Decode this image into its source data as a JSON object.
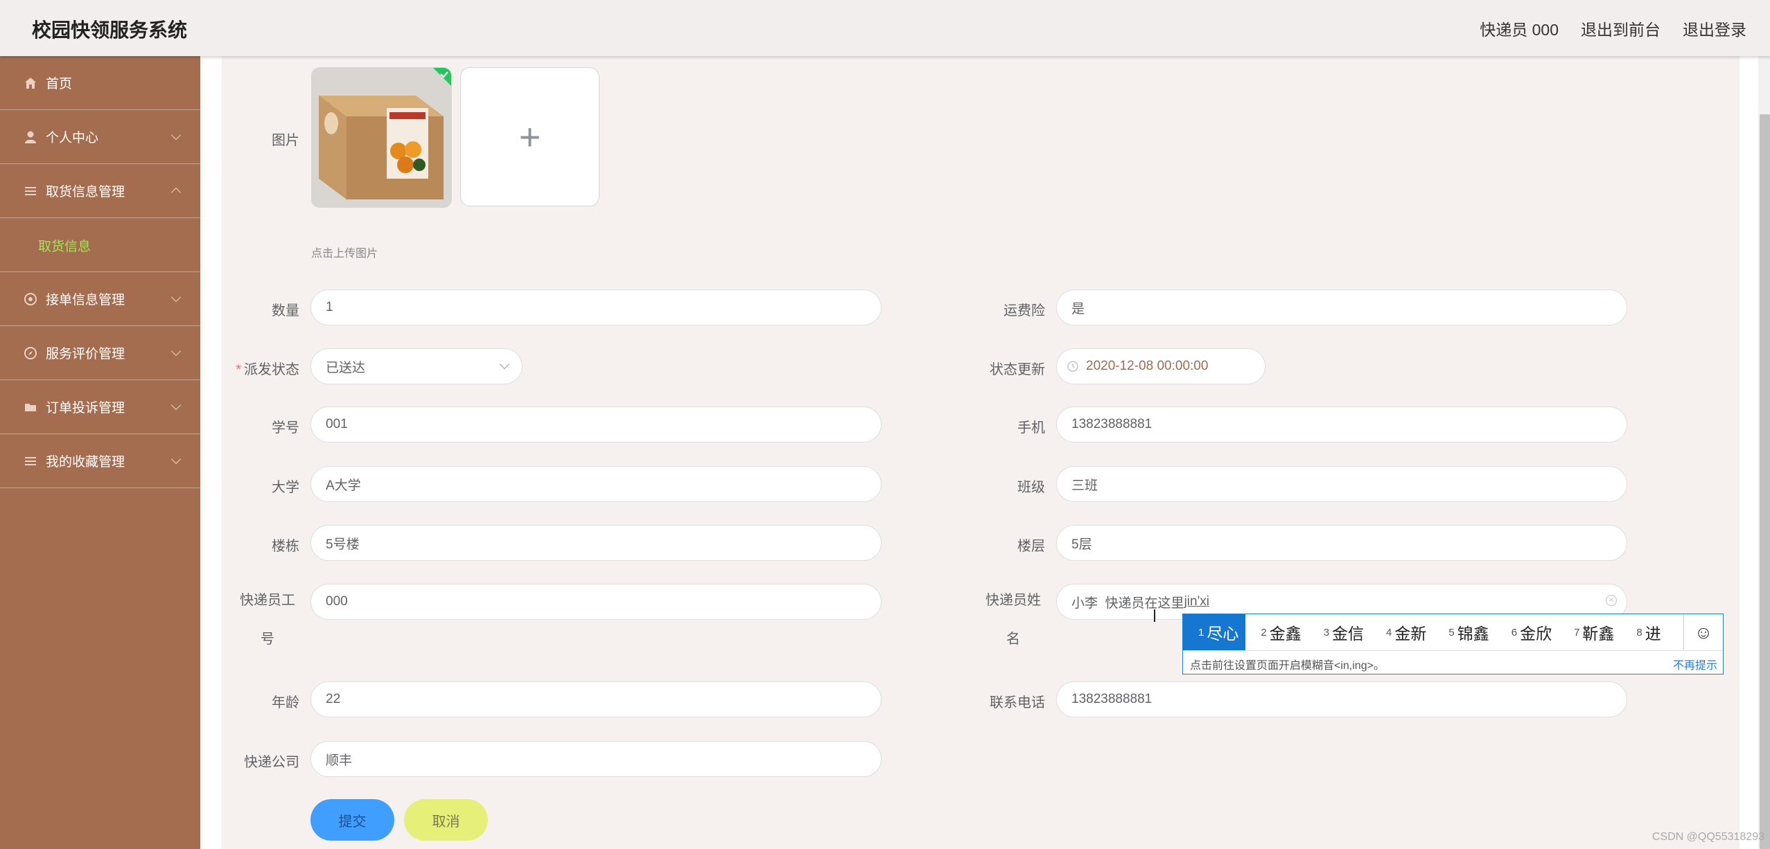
{
  "header": {
    "title": "校园快领服务系统",
    "links": [
      "快递员 000",
      "退出到前台",
      "退出登录"
    ]
  },
  "sidebar": {
    "items": [
      {
        "label": "首页",
        "icon": "home-icon"
      },
      {
        "label": "个人中心",
        "icon": "user-icon"
      },
      {
        "label": "取货信息管理",
        "icon": "menu-icon"
      },
      {
        "label": "取货信息",
        "icon": ""
      },
      {
        "label": "接单信息管理",
        "icon": "gear-icon"
      },
      {
        "label": "服务评价管理",
        "icon": "compass-icon"
      },
      {
        "label": "订单投诉管理",
        "icon": "folder-icon"
      },
      {
        "label": "我的收藏管理",
        "icon": "menu-icon"
      }
    ]
  },
  "form": {
    "image_label": "图片",
    "upload_hint": "点击上传图片",
    "upload_plus": "+",
    "fields": {
      "quantity": {
        "label": "数量",
        "value": "1"
      },
      "insurance": {
        "label": "运费险",
        "value": "是"
      },
      "status": {
        "label": "派发状态",
        "value": "已送达"
      },
      "status_time": {
        "label": "状态更新",
        "value": "2020-12-08 00:00:00"
      },
      "student_id": {
        "label": "学号",
        "value": "001"
      },
      "phone": {
        "label": "手机",
        "value": "13823888881"
      },
      "university": {
        "label": "大学",
        "value": "A大学"
      },
      "class": {
        "label": "班级",
        "value": "三班"
      },
      "building": {
        "label": "楼栋",
        "value": "5号楼"
      },
      "floor": {
        "label": "楼层",
        "value": "5层"
      },
      "courier_id": {
        "label_line1": "快递员工",
        "label_line2": "号",
        "value": "000"
      },
      "courier_name": {
        "label_line1": "快递员姓",
        "label_line2": "名",
        "value": "小李  快递员在这里",
        "composing": "jin'xi"
      },
      "age": {
        "label": "年龄",
        "value": "22"
      },
      "contact": {
        "label": "联系电话",
        "value": "13823888881"
      },
      "company": {
        "label": "快递公司",
        "value": "顺丰"
      }
    },
    "submit_label": "提交",
    "cancel_label": "取消"
  },
  "ime": {
    "candidates": [
      {
        "n": "1",
        "text": "尽心"
      },
      {
        "n": "2",
        "text": "金鑫"
      },
      {
        "n": "3",
        "text": "金信"
      },
      {
        "n": "4",
        "text": "金新"
      },
      {
        "n": "5",
        "text": "锦鑫"
      },
      {
        "n": "6",
        "text": "金欣"
      },
      {
        "n": "7",
        "text": "靳鑫"
      },
      {
        "n": "8",
        "text": "进"
      }
    ],
    "tip": "点击前往设置页面开启模糊音<in,ing>。",
    "dismiss": "不再提示",
    "emoji": "☺"
  },
  "watermark": "CSDN @QQ55318293",
  "colors": {
    "sidebar": "#a46d4f",
    "submenu_active": "#a8e05d",
    "submit": "#409eff",
    "cancel": "#e6ef78",
    "ime_accent": "#1677d0"
  }
}
